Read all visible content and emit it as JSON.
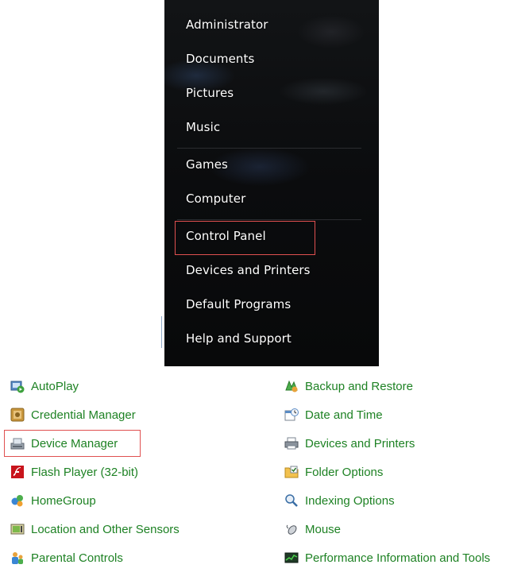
{
  "start_menu": {
    "items": [
      {
        "label": "Administrator"
      },
      {
        "label": "Documents"
      },
      {
        "label": "Pictures"
      },
      {
        "label": "Music"
      },
      {
        "label": "Games"
      },
      {
        "label": "Computer"
      },
      {
        "label": "Control Panel"
      },
      {
        "label": "Devices and Printers"
      },
      {
        "label": "Default Programs"
      },
      {
        "label": "Help and Support"
      }
    ],
    "highlighted_item": "Control Panel",
    "highlight_color": "#e05050"
  },
  "control_panel": {
    "left_column": [
      {
        "label": "AutoPlay",
        "icon": "autoplay-icon"
      },
      {
        "label": "Credential Manager",
        "icon": "credential-manager-icon"
      },
      {
        "label": "Device Manager",
        "icon": "device-manager-icon"
      },
      {
        "label": "Flash Player (32-bit)",
        "icon": "flash-player-icon"
      },
      {
        "label": "HomeGroup",
        "icon": "homegroup-icon"
      },
      {
        "label": "Location and Other Sensors",
        "icon": "sensors-icon"
      },
      {
        "label": "Parental Controls",
        "icon": "parental-controls-icon"
      }
    ],
    "right_column": [
      {
        "label": "Backup and Restore",
        "icon": "backup-restore-icon"
      },
      {
        "label": "Date and Time",
        "icon": "date-time-icon"
      },
      {
        "label": "Devices and Printers",
        "icon": "devices-printers-icon"
      },
      {
        "label": "Folder Options",
        "icon": "folder-options-icon"
      },
      {
        "label": "Indexing Options",
        "icon": "indexing-options-icon"
      },
      {
        "label": "Mouse",
        "icon": "mouse-icon"
      },
      {
        "label": "Performance Information and Tools",
        "icon": "performance-icon"
      }
    ],
    "highlighted_item": "Device Manager",
    "link_color": "#1e8224"
  }
}
